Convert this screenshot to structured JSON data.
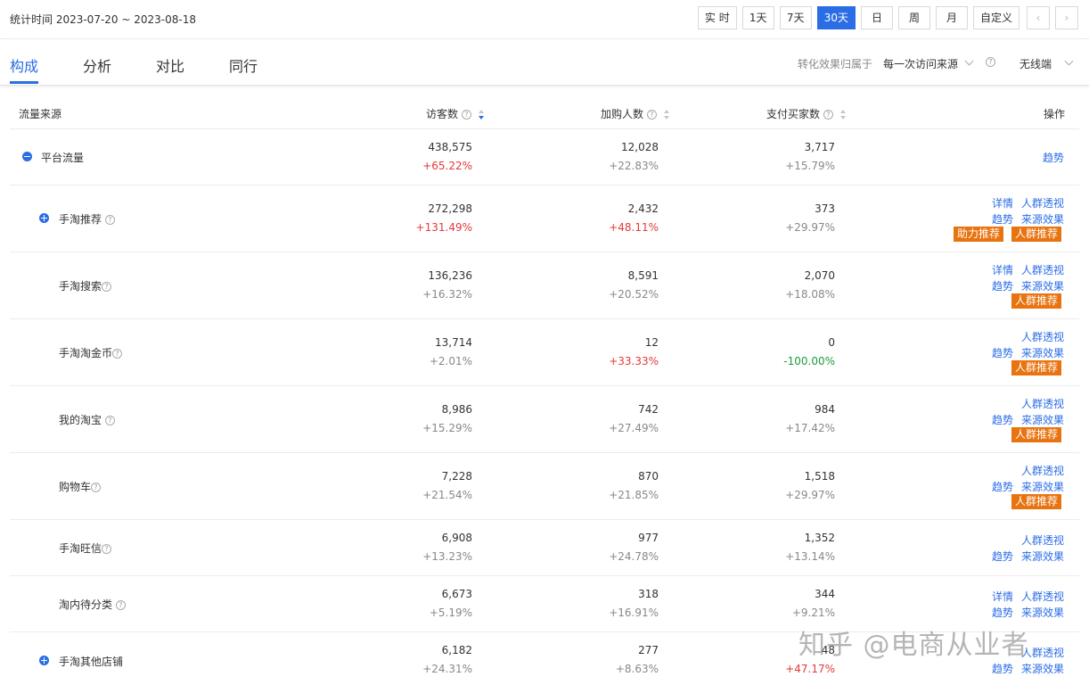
{
  "header": {
    "stat_time": "统计时间 2023-07-20 ~ 2023-08-18",
    "range_buttons": [
      "实 时",
      "1天",
      "7天",
      "30天",
      "日",
      "周",
      "月",
      "自定义"
    ],
    "prev": "‹",
    "next": "›"
  },
  "tabs": [
    "构成",
    "分析",
    "对比",
    "同行"
  ],
  "attribution": {
    "label": "转化效果归属于",
    "value": "每一次访问来源",
    "help": "?",
    "device": "无线端"
  },
  "columns": {
    "source": "流量来源",
    "visitors": "访客数",
    "cart": "加购人数",
    "buyers": "支付买家数",
    "ops": "操作",
    "help": "?"
  },
  "rows": [
    {
      "name": "平台流量",
      "visitors": "438,575",
      "visitors_pct": "+65.22%",
      "cart": "12,028",
      "cart_pct": "+22.83%",
      "buyers": "3,717",
      "buyers_pct": "+15.79%",
      "op1": "趋势"
    },
    {
      "name": "手淘推荐",
      "visitors": "272,298",
      "visitors_pct": "+131.49%",
      "cart": "2,432",
      "cart_pct": "+48.11%",
      "buyers": "373",
      "buyers_pct": "+29.97%",
      "op_detail": "详情",
      "op_crowd": "人群透视",
      "op_trend": "趋势",
      "op_source": "来源效果",
      "badge1": "助力推荐",
      "badge2": "人群推荐"
    },
    {
      "name": "手淘搜索",
      "visitors": "136,236",
      "visitors_pct": "+16.32%",
      "cart": "8,591",
      "cart_pct": "+20.52%",
      "buyers": "2,070",
      "buyers_pct": "+18.08%",
      "op_detail": "详情",
      "op_crowd": "人群透视",
      "op_trend": "趋势",
      "op_source": "来源效果",
      "badge2": "人群推荐"
    },
    {
      "name": "手淘淘金币",
      "visitors": "13,714",
      "visitors_pct": "+2.01%",
      "cart": "12",
      "cart_pct": "+33.33%",
      "buyers": "0",
      "buyers_pct": "-100.00%",
      "op_crowd": "人群透视",
      "op_trend": "趋势",
      "op_source": "来源效果",
      "badge2": "人群推荐"
    },
    {
      "name": "我的淘宝",
      "visitors": "8,986",
      "visitors_pct": "+15.29%",
      "cart": "742",
      "cart_pct": "+27.49%",
      "buyers": "984",
      "buyers_pct": "+17.42%",
      "op_crowd": "人群透视",
      "op_trend": "趋势",
      "op_source": "来源效果",
      "badge2": "人群推荐"
    },
    {
      "name": "购物车",
      "visitors": "7,228",
      "visitors_pct": "+21.54%",
      "cart": "870",
      "cart_pct": "+21.85%",
      "buyers": "1,518",
      "buyers_pct": "+29.97%",
      "op_crowd": "人群透视",
      "op_trend": "趋势",
      "op_source": "来源效果",
      "badge2": "人群推荐"
    },
    {
      "name": "手淘旺信",
      "visitors": "6,908",
      "visitors_pct": "+13.23%",
      "cart": "977",
      "cart_pct": "+24.78%",
      "buyers": "1,352",
      "buyers_pct": "+13.14%",
      "op_crowd": "人群透视",
      "op_trend": "趋势",
      "op_source": "来源效果"
    },
    {
      "name": "淘内待分类",
      "visitors": "6,673",
      "visitors_pct": "+5.19%",
      "cart": "318",
      "cart_pct": "+16.91%",
      "buyers": "344",
      "buyers_pct": "+9.21%",
      "op_detail": "详情",
      "op_crowd": "人群透视",
      "op_trend": "趋势",
      "op_source": "来源效果"
    },
    {
      "name": "手淘其他店铺",
      "visitors": "6,182",
      "visitors_pct": "+24.31%",
      "cart": "277",
      "cart_pct": "+8.63%",
      "buyers": "48",
      "buyers_pct": "+47.17%",
      "op_crowd": "人群透视",
      "op_trend": "趋势",
      "op_source": "来源效果"
    }
  ],
  "watermark": "知乎 @电商从业者",
  "colors": {
    "accent": "#2b6de5",
    "up": "#e33a3a",
    "down": "#1e9c3c",
    "badge": "#e8730f"
  }
}
